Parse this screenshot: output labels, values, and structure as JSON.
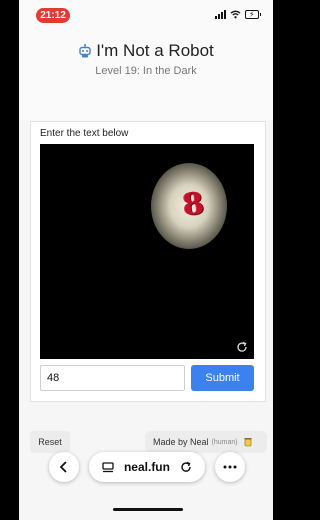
{
  "status": {
    "time": "21:12"
  },
  "page": {
    "title": "I'm Not a Robot",
    "subtitle": "Level 19: In the Dark"
  },
  "captcha": {
    "prompt": "Enter the text below",
    "glyph": "8",
    "input_value": "48",
    "submit_label": "Submit"
  },
  "footer": {
    "reset_label": "Reset",
    "made_by": "Made by Neal",
    "made_by_note": "(human)"
  },
  "browser": {
    "url": "neal.fun"
  },
  "colors": {
    "accent": "#3b82f0",
    "status_pill": "#e53935",
    "glyph": "#c0122a"
  }
}
